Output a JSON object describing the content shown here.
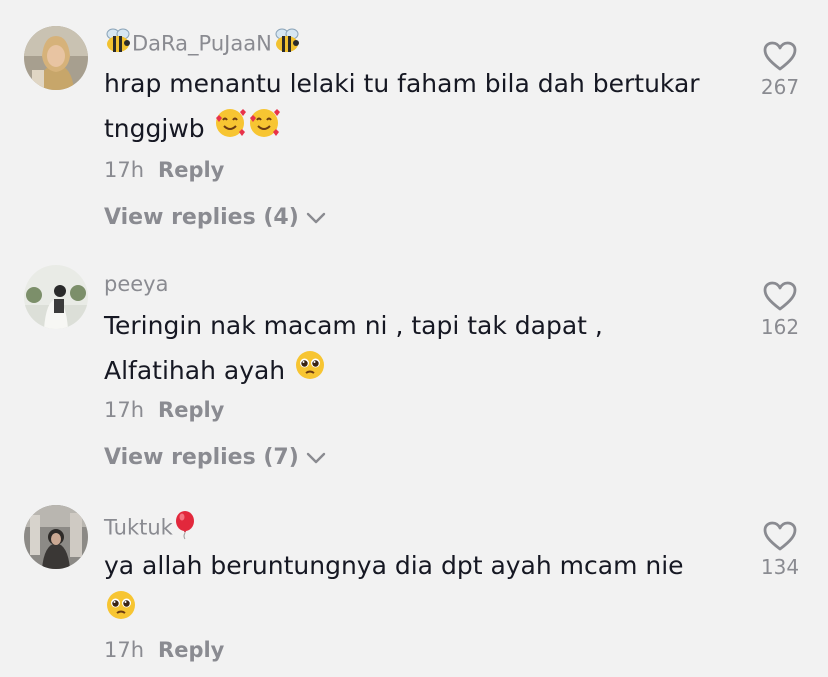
{
  "comments": [
    {
      "username": "DaRa_PuJaaN",
      "username_prefix_icon": "bee-icon",
      "username_suffix_icon": "bee-icon",
      "text_line1": "hrap menantu lelaki tu faham bila dah bertukar",
      "text_line2": "tnggjwb",
      "text_emojis": [
        "smiling-face-with-hearts-emoji",
        "smiling-face-with-hearts-emoji"
      ],
      "time": "17h",
      "reply_label": "Reply",
      "view_replies": "View replies (4)",
      "likes": "267"
    },
    {
      "username": "peeya",
      "text_line1": "Teringin nak macam ni , tapi tak dapat ,",
      "text_line2": "Alfatihah ayah",
      "text_emojis": [
        "pleading-face-emoji"
      ],
      "time": "17h",
      "reply_label": "Reply",
      "view_replies": "View replies (7)",
      "likes": "162"
    },
    {
      "username": "Tuktuk",
      "username_suffix_icon": "balloon-icon",
      "text_line1": "ya allah beruntungnya dia dpt ayah mcam nie",
      "text_emojis": [
        "pleading-face-emoji"
      ],
      "time": "17h",
      "reply_label": "Reply",
      "likes": "134"
    }
  ],
  "colors": {
    "background": "#f2f2f2",
    "primary_text": "#161823",
    "secondary_text": "#8a8b91"
  }
}
